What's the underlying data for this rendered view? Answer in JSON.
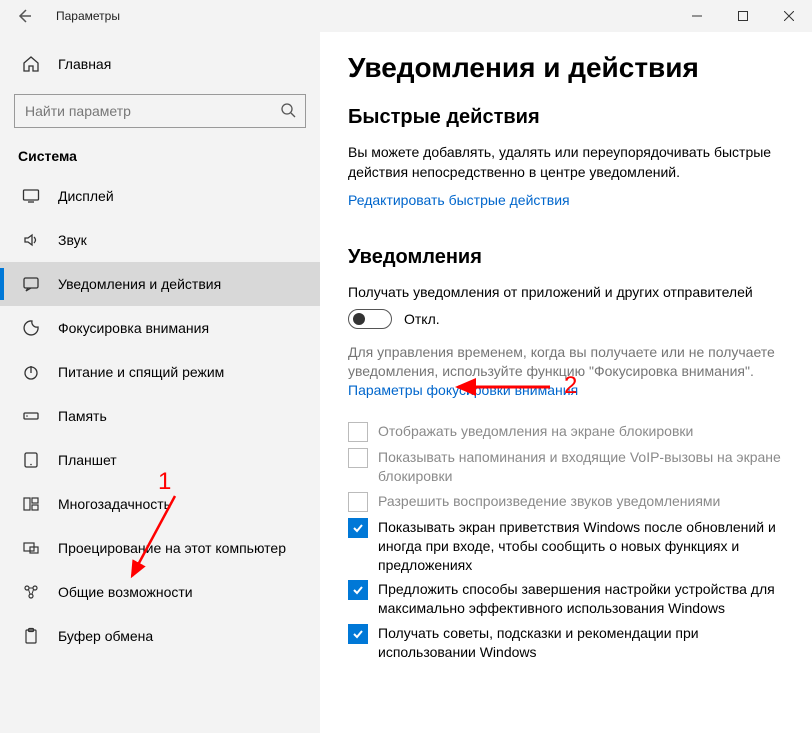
{
  "window": {
    "title": "Параметры"
  },
  "sidebar": {
    "home": "Главная",
    "search_placeholder": "Найти параметр",
    "section": "Система",
    "items": [
      {
        "label": "Дисплей",
        "icon": "display-icon"
      },
      {
        "label": "Звук",
        "icon": "sound-icon"
      },
      {
        "label": "Уведомления и действия",
        "icon": "notifications-icon",
        "selected": true
      },
      {
        "label": "Фокусировка внимания",
        "icon": "focus-assist-icon"
      },
      {
        "label": "Питание и спящий режим",
        "icon": "power-icon"
      },
      {
        "label": "Память",
        "icon": "storage-icon"
      },
      {
        "label": "Планшет",
        "icon": "tablet-icon"
      },
      {
        "label": "Многозадачность",
        "icon": "multitasking-icon"
      },
      {
        "label": "Проецирование на этот компьютер",
        "icon": "projecting-icon"
      },
      {
        "label": "Общие возможности",
        "icon": "shared-experiences-icon"
      },
      {
        "label": "Буфер обмена",
        "icon": "clipboard-icon"
      }
    ]
  },
  "page": {
    "title": "Уведомления и действия",
    "quick_heading": "Быстрые действия",
    "quick_desc": "Вы можете добавлять, удалять или переупорядочивать быстрые действия непосредственно в центре уведомлений.",
    "edit_link": "Редактировать быстрые действия",
    "notif_heading": "Уведомления",
    "notif_toggle_label": "Получать уведомления от приложений и других отправителей",
    "toggle_state": "Откл.",
    "helper_text": "Для управления временем, когда вы получаете или не получаете уведомления, используйте функцию \"Фокусировка внимания\".",
    "focus_link": "Параметры фокусировки внимания",
    "checks": [
      {
        "label": "Отображать уведомления на экране блокировки",
        "checked": false,
        "disabled": true
      },
      {
        "label": "Показывать напоминания и входящие VoIP-вызовы на экране блокировки",
        "checked": false,
        "disabled": true
      },
      {
        "label": "Разрешить  воспроизведение звуков уведомлениями",
        "checked": false,
        "disabled": true
      },
      {
        "label": "Показывать экран приветствия Windows после обновлений и иногда при входе, чтобы сообщить о новых функциях и предложениях",
        "checked": true,
        "disabled": false
      },
      {
        "label": "Предложить способы завершения настройки устройства для максимально эффективного использования Windows",
        "checked": true,
        "disabled": false
      },
      {
        "label": "Получать советы, подсказки и рекомендации при использовании Windows",
        "checked": true,
        "disabled": false
      }
    ]
  },
  "annotations": {
    "one": "1",
    "two": "2"
  }
}
